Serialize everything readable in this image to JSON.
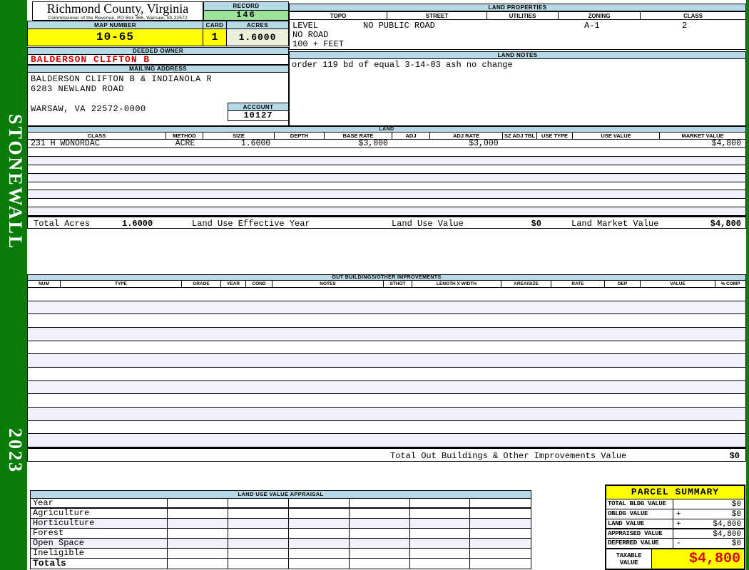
{
  "sidebar": {
    "district": "STONEWALL",
    "year": "2023"
  },
  "header": {
    "county": "Richmond County, Virginia",
    "commissioner": "Commissioner of the Revenue, PO Box 366, Warsaw, VA 22572",
    "record_label": "RECORD",
    "record_value": "146",
    "map_number_label": "MAP NUMBER",
    "map_number_value": "10-65",
    "card_label": "CARD",
    "card_value": "1",
    "acres_label": "ACRES",
    "acres_value": "1.6000"
  },
  "owner": {
    "deeded_owner_label": "DEEDED OWNER",
    "deeded_owner": "BALDERSON CLIFTON B",
    "mailing_address_label": "MAILING ADDRESS",
    "address_lines": [
      "BALDERSON CLIFTON B & INDIANOLA R",
      "6283 NEWLAND ROAD",
      "",
      "WARSAW, VA 22572-0000"
    ],
    "account_label": "ACCOUNT",
    "account_value": "10127"
  },
  "land_properties": {
    "title": "LAND PROPERTIES",
    "headers": [
      "TOPO",
      "STREET",
      "UTILITIES",
      "ZONING",
      "CLASS"
    ],
    "topo": "LEVEL",
    "street": "NO PUBLIC ROAD",
    "utilities": "",
    "zoning": "A-1",
    "class": "2",
    "topo_extra": [
      "NO ROAD",
      "100 + FEET"
    ]
  },
  "land_notes": {
    "title": "LAND NOTES",
    "text": "order 119 bd of equal 3-14-03 ash no change"
  },
  "land": {
    "title": "LAND",
    "headers": [
      "CLASS",
      "METHOD",
      "SIZE",
      "DEPTH",
      "BASE RATE",
      "ADJ",
      "ADJ RATE",
      "SZ ADJ TBL",
      "USE TYPE",
      "USE VALUE",
      "MARKET VALUE"
    ],
    "row": [
      "231 H WDNORDAC",
      "ACRE",
      "1.6000",
      "",
      "$3,000",
      "",
      "$3,000",
      "",
      "",
      "",
      "$4,800"
    ],
    "totals": {
      "acres_label": "Total Acres",
      "acres": "1.6000",
      "effective_year_label": "Land Use Effective Year",
      "use_value_label": "Land Use Value",
      "use_value": "$0",
      "market_value_label": "Land Market Value",
      "market_value": "$4,800"
    }
  },
  "out_buildings": {
    "title": "OUT BUILDINGS/OTHER IMPROVEMENTS",
    "headers": [
      "NUM",
      "TYPE",
      "GRADE",
      "YEAR",
      "COND",
      "NOTES",
      "STHGT",
      "LENGTH X WIDTH",
      "AREA/SIZE",
      "RATE",
      "DEP",
      "VALUE",
      "% COMP"
    ],
    "total_label": "Total Out Buildings & Other Improvements Value",
    "total_value": "$0"
  },
  "land_use_appraisal": {
    "title": "LAND USE VALUE APPRAISAL",
    "row_labels": [
      "Year",
      "Agriculture",
      "Horticulture",
      "Forest",
      "Open Space",
      "Ineligible",
      "Totals"
    ]
  },
  "parcel_summary": {
    "title": "PARCEL SUMMARY",
    "rows": [
      {
        "label": "TOTAL BLDG VALUE",
        "op": "",
        "value": "$0"
      },
      {
        "label": "OBLDG VALUE",
        "op": "+",
        "value": "$0"
      },
      {
        "label": "LAND VALUE",
        "op": "+",
        "value": "$4,800"
      },
      {
        "label": "APPRAISED VALUE",
        "op": "",
        "value": "$4,800"
      },
      {
        "label": "DEFERRED VALUE",
        "op": "-",
        "value": "$0"
      }
    ],
    "taxable_label_line1": "TAXABLE",
    "taxable_label_line2": "VALUE",
    "taxable_value": "$4,800"
  },
  "colors": {
    "page_green": "#0a7c0a",
    "section_header_blue": "#b5d9e7",
    "highlight_yellow": "#ffff00",
    "record_green": "#9ce49c",
    "acres_beige": "#ededdb",
    "owner_red": "#cc0000",
    "taxable_red": "#dd0000"
  }
}
